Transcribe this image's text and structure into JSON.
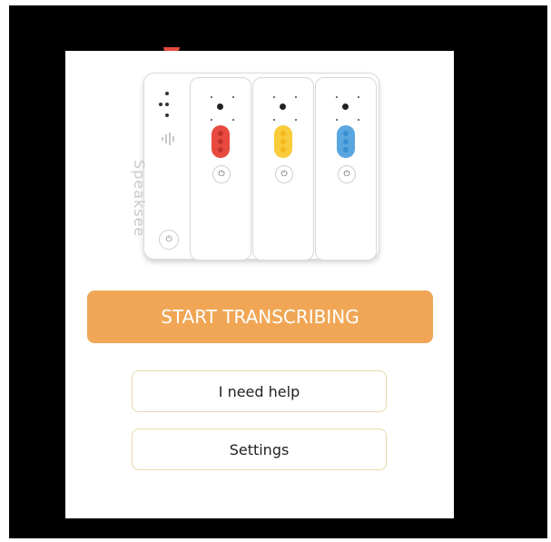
{
  "buttons": {
    "start": "START TRANSCRIBING",
    "help": "I need help",
    "settings": "Settings"
  },
  "device": {
    "brand": "Speaksee",
    "units": [
      {
        "color_name": "red",
        "color": "#e84a3f"
      },
      {
        "color_name": "yellow",
        "color": "#f8cc3a"
      },
      {
        "color_name": "blue",
        "color": "#5aa6e0"
      }
    ]
  },
  "colors": {
    "accent": "#f0a655",
    "outline": "#e6d8b0",
    "frame": "#000000"
  },
  "icons": [
    "power-icon",
    "speaksee-logo-icon",
    "microphone-icon",
    "dock-button-icon"
  ]
}
